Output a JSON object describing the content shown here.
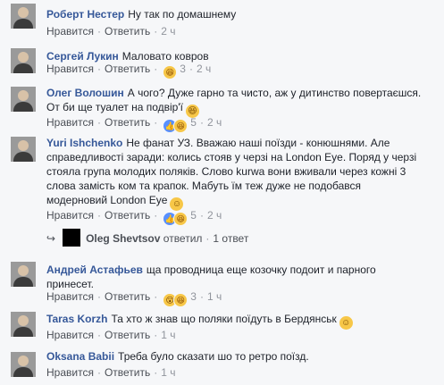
{
  "actions": {
    "like_label": "Нравится",
    "reply_label": "Ответить",
    "separator": "·"
  },
  "comments": [
    {
      "author": "Роберт Нестер",
      "text": "Ну так по домашнему",
      "time": "2 ч",
      "reactions": null
    },
    {
      "author": "Сергей Лукин",
      "text": "Маловато ковров",
      "time": "2 ч",
      "reactions": {
        "types": [
          "haha"
        ],
        "count": "3"
      }
    },
    {
      "author": "Олег Волошин",
      "text": "А чого? Дуже гарно та чисто, аж у дитинство повертаєшся. От би ще туалет на подвір'ї",
      "emoji": "laughing-emoji",
      "time": "2 ч",
      "reactions": {
        "types": [
          "like",
          "haha"
        ],
        "count": "5"
      }
    },
    {
      "author": "Yuri Ishchenko",
      "text_lines": [
        "Не фанат УЗ. Вважаю наші поїзди - конюшнями. Але",
        "справедливості заради: колись стояв у черзі на London Eye. Поряд у черзі",
        "стояла група молодих поляків. Слово kurwa вони вживали через кожні 3",
        "слова замість ком та крапок. Мабуть їм теж дуже не подобався",
        "модерновий London Eye"
      ],
      "emoji": "smile-emoji",
      "time": "2 ч",
      "reactions": {
        "types": [
          "like",
          "haha"
        ],
        "count": "5"
      }
    },
    {
      "author": "Андрей Астафьев",
      "text_lines": [
        "ща проводница еще козочку подоит и парного",
        "принесет."
      ],
      "time": "1 ч",
      "reactions": {
        "types": [
          "wow",
          "haha"
        ],
        "count": "3"
      }
    },
    {
      "author": "Taras Korzh",
      "text": "Та хто ж знав що поляки поїдуть в Бердянськ",
      "emoji": "smile-emoji",
      "time": "1 ч",
      "reactions": null
    },
    {
      "author": "Oksana Babii",
      "text": "Треба було сказати шо то ретро поїзд.",
      "time": "1 ч",
      "reactions": null
    }
  ],
  "reply_thread": {
    "name": "Oleg Shevtsov",
    "verb": "ответил",
    "count": "1 ответ"
  }
}
